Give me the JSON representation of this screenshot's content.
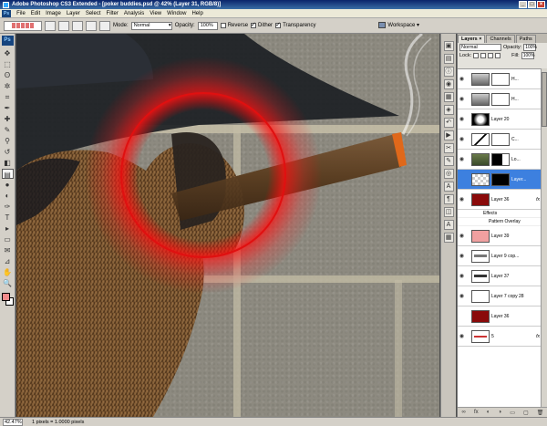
{
  "window": {
    "title": "Adobe Photoshop CS3 Extended - [poker buddies.psd @ 42% (Layer 31, RGB/8)]",
    "minimize": "_",
    "maximize": "□",
    "close": "×"
  },
  "menubar": {
    "logo": "Ps",
    "items": [
      "File",
      "Edit",
      "Image",
      "Layer",
      "Select",
      "Filter",
      "Analysis",
      "View",
      "Window",
      "Help"
    ]
  },
  "options": {
    "mode_label": "Mode:",
    "mode_value": "Normal",
    "opacity_label": "Opacity:",
    "opacity_value": "100%",
    "reverse_label": "Reverse",
    "dither_label": "Dither",
    "transparency_label": "Transparency",
    "workspace_label": "Workspace ▾"
  },
  "tools": {
    "badge": "Ps",
    "icons": [
      "move-icon",
      "marquee-icon",
      "lasso-icon",
      "magic-wand-icon",
      "crop-icon",
      "eyedropper-icon",
      "healing-icon",
      "brush-icon",
      "stamp-icon",
      "history-brush-icon",
      "eraser-icon",
      "gradient-icon",
      "blur-icon",
      "dodge-icon",
      "pen-icon",
      "type-icon",
      "path-select-icon",
      "shape-icon",
      "notes-icon",
      "eyedropper2-icon",
      "hand-icon",
      "zoom-icon"
    ],
    "glyphs": [
      "✥",
      "⬚",
      "ʘ",
      "✲",
      "⌗",
      "✒",
      "✚",
      "✎",
      "⚲",
      "↺",
      "◧",
      "▤",
      "●",
      "◐",
      "✑",
      "T",
      "▸",
      "▭",
      "✉",
      "⊿",
      "✋",
      "🔍"
    ],
    "fg_color": "#f48a8a",
    "bg_color": "#ffffff"
  },
  "dock": {
    "icons": [
      "navigator-icon",
      "histogram-icon",
      "info-icon",
      "color-icon",
      "swatches-icon",
      "styles-icon",
      "history-icon",
      "actions-icon",
      "tools-presets-icon",
      "brushes-icon",
      "clone-source-icon",
      "character-icon",
      "paragraph-icon",
      "layer-comps-icon",
      "text-icon",
      "animation-icon"
    ],
    "glyphs": [
      "▣",
      "▤",
      "ⓘ",
      "◉",
      "▦",
      "◈",
      "↶",
      "▶",
      "✂",
      "✎",
      "◎",
      "A",
      "¶",
      "◫",
      "A",
      "▦"
    ]
  },
  "layers_panel": {
    "tabs": [
      "Layers ×",
      "Channels",
      "Paths"
    ],
    "blend_mode": "Normal",
    "opacity_label": "Opacity:",
    "opacity_value": "100%",
    "lock_label": "Lock:",
    "fill_label": "Fill:",
    "fill_value": "100%",
    "layers": [
      {
        "name": "H...",
        "type": "adjustment",
        "visible": true
      },
      {
        "name": "H...",
        "type": "adjustment",
        "visible": true
      },
      {
        "name": "Layer 20",
        "type": "glow",
        "visible": true
      },
      {
        "name": "C...",
        "type": "curves",
        "visible": true
      },
      {
        "name": "Lo...",
        "type": "masked",
        "visible": true
      },
      {
        "name": "Layer...",
        "type": "selected",
        "visible": false
      },
      {
        "name": "Layer 36",
        "type": "red",
        "visible": true,
        "fx": "fx"
      },
      {
        "name": "Layer 39",
        "type": "pink",
        "visible": true
      },
      {
        "name": "Layer 9 cop...",
        "type": "strip",
        "visible": true
      },
      {
        "name": "Layer 37",
        "type": "strip2",
        "visible": true
      },
      {
        "name": "Layer 7 copy 28",
        "type": "blank",
        "visible": true
      },
      {
        "name": "Layer 36",
        "type": "red",
        "visible": false
      },
      {
        "name": "5",
        "type": "strip3",
        "visible": true,
        "fx": "fx"
      }
    ],
    "effects_label": "Effects",
    "pattern_overlay_label": "Pattern Overlay",
    "bottom_icons": [
      "∞",
      "fx",
      "◐",
      "◑",
      "▭",
      "▢",
      "🗑"
    ]
  },
  "status": {
    "zoom": "42.47%",
    "doc_info": "1 pixels = 1.0000 pixels"
  }
}
